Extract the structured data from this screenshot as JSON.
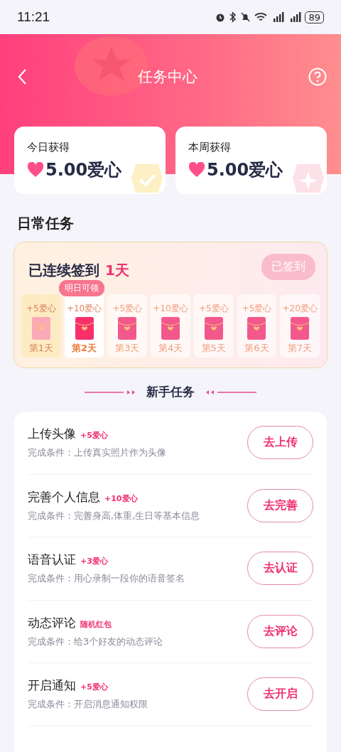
{
  "status_bar": {
    "time": "11:21",
    "battery": "89"
  },
  "nav": {
    "title": "任务中心"
  },
  "stats": [
    {
      "label": "今日获得",
      "value": "5.00爱心",
      "kind": "check"
    },
    {
      "label": "本周获得",
      "value": "5.00爱心",
      "kind": "sparkle"
    }
  ],
  "daily": {
    "title": "日常任务",
    "streak_label": "已连续签到",
    "streak_value": "1天",
    "button": {
      "label": "已签到",
      "disabled": true
    },
    "days": [
      {
        "reward": "+5爱心",
        "label": "第1天",
        "kind": "claimed"
      },
      {
        "reward": "+10爱心",
        "label": "第2天",
        "kind": "next",
        "tip": "明日可领"
      },
      {
        "reward": "+5爱心",
        "label": "第3天",
        "kind": "pending"
      },
      {
        "reward": "+10爱心",
        "label": "第4天",
        "kind": "pending"
      },
      {
        "reward": "+5爱心",
        "label": "第5天",
        "kind": "pending"
      },
      {
        "reward": "+5爱心",
        "label": "第6天",
        "kind": "pending"
      },
      {
        "reward": "+20爱心",
        "label": "第7天",
        "kind": "pending"
      }
    ]
  },
  "newbie": {
    "title": "新手任务",
    "tasks": [
      {
        "title": "上传头像",
        "reward": "+5爱心",
        "condition": "完成条件：上传真实照片作为头像",
        "button": "去上传"
      },
      {
        "title": "完善个人信息",
        "reward": "+10爱心",
        "condition": "完成条件：完善身高,体重,生日等基本信息",
        "button": "去完善"
      },
      {
        "title": "语音认证",
        "reward": "+3爱心",
        "condition": "完成条件：用心录制一段你的语音签名",
        "button": "去认证"
      },
      {
        "title": "动态评论",
        "reward": "随机红包",
        "condition": "完成条件：给3个好友的动态评论",
        "button": "去评论"
      },
      {
        "title": "开启通知",
        "reward": "+5爱心",
        "condition": "完成条件：开启消息通知权限",
        "button": "去开启"
      }
    ]
  }
}
